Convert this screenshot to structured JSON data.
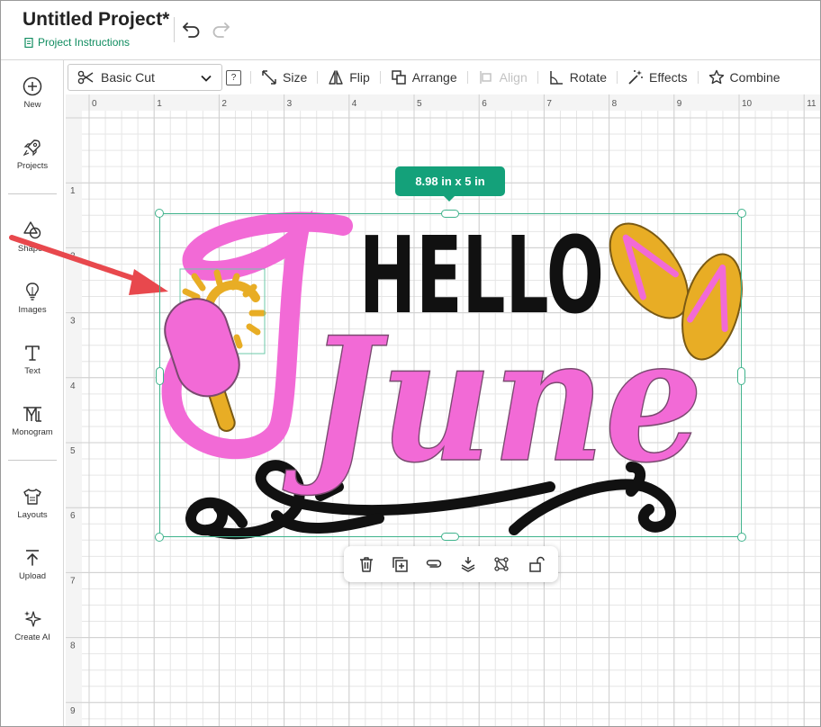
{
  "header": {
    "title": "Untitled Project*",
    "instructions_link": "Project Instructions"
  },
  "sidebar": {
    "items": [
      {
        "label": "New",
        "icon": "plus-circle-icon"
      },
      {
        "label": "Projects",
        "icon": "rocket-icon"
      },
      {
        "label": "Shapes",
        "icon": "shapes-icon"
      },
      {
        "label": "Images",
        "icon": "lightbulb-icon"
      },
      {
        "label": "Text",
        "icon": "text-icon"
      },
      {
        "label": "Monogram",
        "icon": "monogram-icon"
      },
      {
        "label": "Layouts",
        "icon": "shirt-icon"
      },
      {
        "label": "Upload",
        "icon": "upload-icon"
      },
      {
        "label": "Create AI",
        "icon": "sparkles-icon"
      }
    ]
  },
  "toolbar": {
    "operation": "Basic Cut",
    "help": "?",
    "size": "Size",
    "flip": "Flip",
    "arrange": "Arrange",
    "align": "Align",
    "rotate": "Rotate",
    "effects": "Effects",
    "combine": "Combine"
  },
  "ruler": {
    "horizontal": [
      "0",
      "1",
      "2",
      "3",
      "4",
      "5",
      "6",
      "7",
      "8",
      "9",
      "10",
      "11"
    ],
    "vertical": [
      "1",
      "2",
      "3",
      "4",
      "5",
      "6",
      "7",
      "8",
      "9"
    ]
  },
  "selection": {
    "size_label": "8.98  in x 5  in"
  },
  "design": {
    "word1": "HELLO",
    "word2": "June"
  },
  "colors": {
    "accent": "#14a17a",
    "selection": "#3fb38c",
    "pink": "#f26ad6",
    "gold": "#e8ad25",
    "arrow": "#e8484d"
  }
}
